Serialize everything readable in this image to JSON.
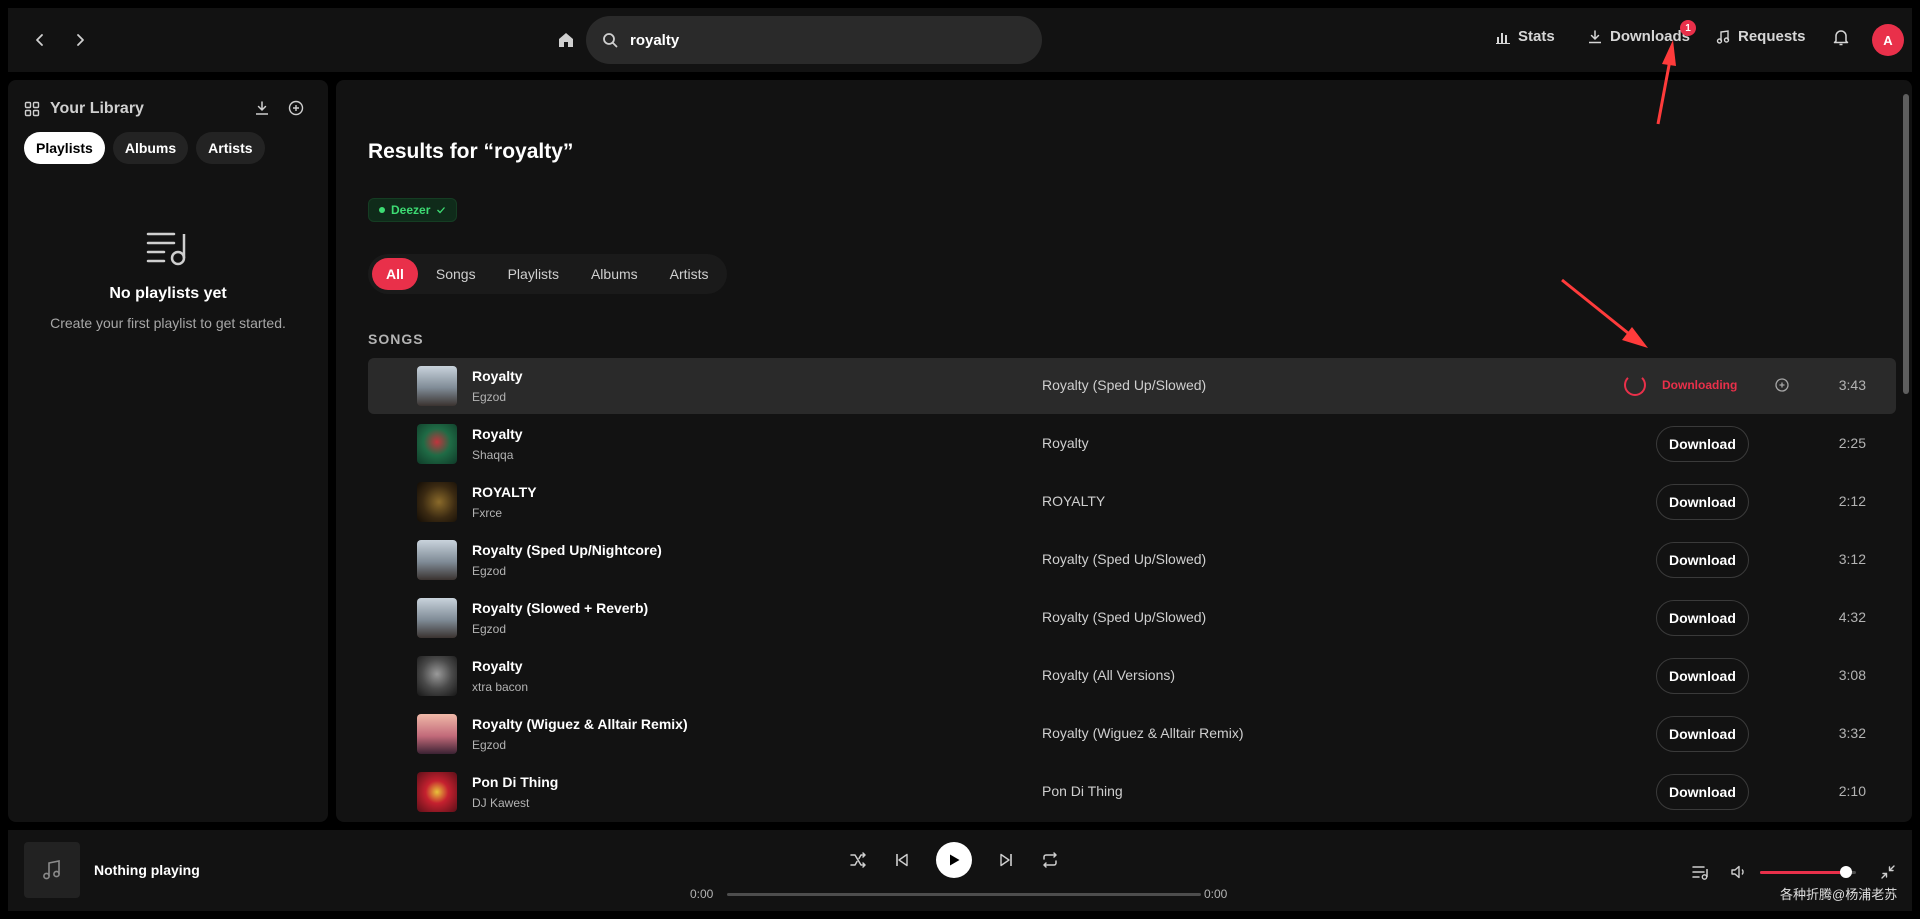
{
  "topbar": {
    "search_value": "royalty",
    "stats_label": "Stats",
    "downloads_label": "Downloads",
    "downloads_badge": "1",
    "requests_label": "Requests",
    "avatar_letter": "A"
  },
  "sidebar": {
    "title": "Your Library",
    "chips": [
      "Playlists",
      "Albums",
      "Artists"
    ],
    "empty_title": "No playlists yet",
    "empty_sub": "Create your first playlist to get started."
  },
  "main": {
    "results_title": "Results for “royalty”",
    "source_badge": "Deezer",
    "tabs": [
      "All",
      "Songs",
      "Playlists",
      "Albums",
      "Artists"
    ],
    "section_label": "SONGS",
    "download_label": "Download",
    "downloading_label": "Downloading",
    "songs": [
      {
        "title": "Royalty",
        "artist": "Egzod",
        "album": "Royalty (Sped Up/Slowed)",
        "duration": "3:43",
        "status": "downloading"
      },
      {
        "title": "Royalty",
        "artist": "Shaqqa",
        "album": "Royalty",
        "duration": "2:25",
        "status": "idle"
      },
      {
        "title": "ROYALTY",
        "artist": "Fxrce",
        "album": "ROYALTY",
        "duration": "2:12",
        "status": "idle"
      },
      {
        "title": "Royalty (Sped Up/Nightcore)",
        "artist": "Egzod",
        "album": "Royalty (Sped Up/Slowed)",
        "duration": "3:12",
        "status": "idle"
      },
      {
        "title": "Royalty (Slowed + Reverb)",
        "artist": "Egzod",
        "album": "Royalty (Sped Up/Slowed)",
        "duration": "4:32",
        "status": "idle"
      },
      {
        "title": "Royalty",
        "artist": "xtra bacon",
        "album": "Royalty (All Versions)",
        "duration": "3:08",
        "status": "idle"
      },
      {
        "title": "Royalty (Wiguez & Alltair Remix)",
        "artist": "Egzod",
        "album": "Royalty (Wiguez & Alltair Remix)",
        "duration": "3:32",
        "status": "idle"
      },
      {
        "title": "Pon Di Thing",
        "artist": "DJ Kawest",
        "album": "Pon Di Thing",
        "duration": "2:10",
        "status": "idle"
      }
    ]
  },
  "player": {
    "now_playing": "Nothing playing",
    "time_current": "0:00",
    "time_total": "0:00",
    "volume": 0.9
  },
  "watermark": "各种折腾@杨浦老苏",
  "colors": {
    "accent": "#e9304a",
    "source_green": "#3ddc73",
    "background": "#121212"
  }
}
